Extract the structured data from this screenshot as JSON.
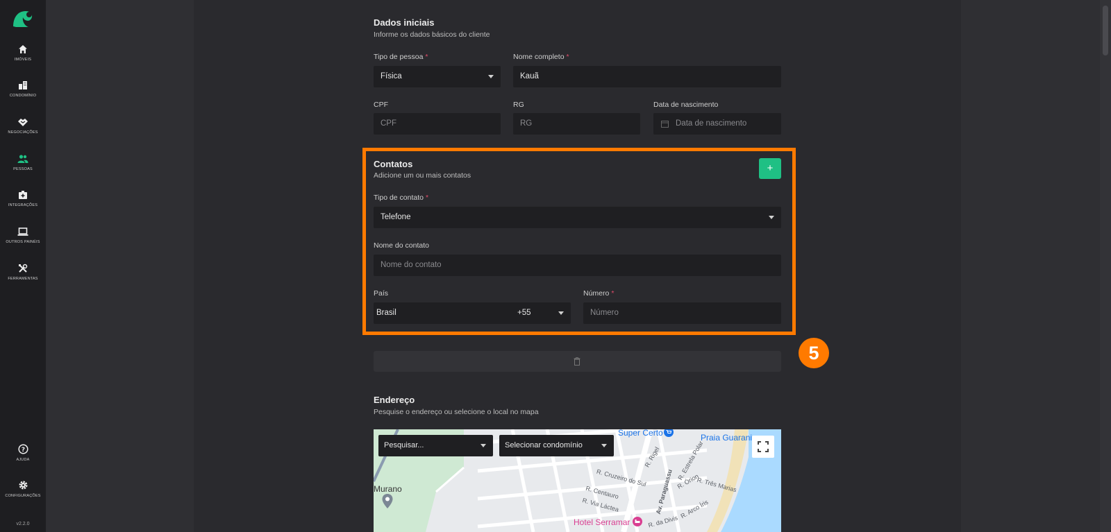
{
  "sidebar": {
    "items": [
      {
        "label": "IMÓVEIS",
        "icon": "home-icon"
      },
      {
        "label": "CONDOMÍNIO",
        "icon": "buildings-icon"
      },
      {
        "label": "NEGOCIAÇÕES",
        "icon": "handshake-icon"
      },
      {
        "label": "PESSOAS",
        "icon": "people-icon"
      },
      {
        "label": "INTEGRAÇÕES",
        "icon": "integrations-icon"
      },
      {
        "label": "OUTROS PAINÉIS",
        "icon": "laptop-icon"
      },
      {
        "label": "FERRAMENTAS",
        "icon": "tools-icon"
      }
    ],
    "bottom": [
      {
        "label": "AJUDA",
        "icon": "help-icon"
      },
      {
        "label": "CONFIGURAÇÕES",
        "icon": "gear-icon"
      }
    ],
    "version": "v2.2.0",
    "active_color": "#1fc084"
  },
  "dados": {
    "title": "Dados iniciais",
    "subtitle": "Informe os dados básicos do cliente",
    "tipo_pessoa_label": "Tipo de pessoa",
    "tipo_pessoa_value": "Física",
    "nome_label": "Nome completo",
    "nome_value": "Kauã",
    "cpf_label": "CPF",
    "cpf_placeholder": "CPF",
    "rg_label": "RG",
    "rg_placeholder": "RG",
    "nasc_label": "Data de nascimento",
    "nasc_placeholder": "Data de nascimento"
  },
  "contatos": {
    "title": "Contatos",
    "subtitle": "Adicione um ou mais contatos",
    "add_label": "+",
    "tipo_label": "Tipo de contato",
    "tipo_value": "Telefone",
    "nome_label": "Nome do contato",
    "nome_placeholder": "Nome do contato",
    "pais_label": "País",
    "pais_value": "Brasil",
    "pais_code": "+55",
    "numero_label": "Número",
    "numero_placeholder": "Número",
    "required_mark": "*"
  },
  "callout": {
    "number": "5",
    "color": "#ff7a00"
  },
  "endereco": {
    "title": "Endereço",
    "subtitle": "Pesquise o endereço ou selecione o local no mapa",
    "search_placeholder": "Pesquisar...",
    "condominio_placeholder": "Selecionar condomínio",
    "places": {
      "super_certo": "Super Certo",
      "praia_guarani": "Praia Guarani",
      "murano": "Murano",
      "hotel_serramar": "Hotel Serramar"
    },
    "streets": [
      "R. Cruzeiro do Sul",
      "R. Rigel",
      "Av. Paraguassu",
      "R. Estrela Polar",
      "R. Órion",
      "R. Três Marias",
      "R. Centauro",
      "R. Via Láctea",
      "R. Arco Íris",
      "R. da Divis"
    ]
  }
}
